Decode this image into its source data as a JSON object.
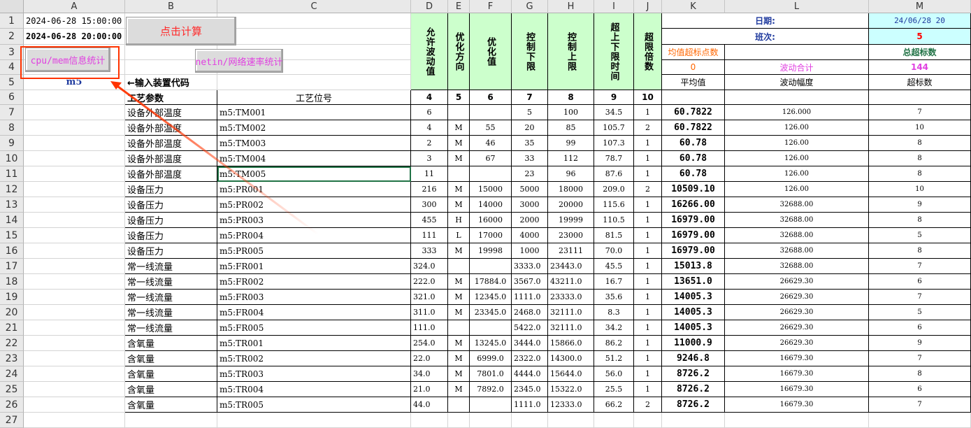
{
  "columns": [
    "A",
    "B",
    "C",
    "D",
    "E",
    "F",
    "G",
    "H",
    "I",
    "J",
    "K",
    "L",
    "M"
  ],
  "rows": [
    "1",
    "2",
    "3",
    "4",
    "5",
    "6",
    "7",
    "8",
    "9",
    "10",
    "11",
    "12",
    "13",
    "14",
    "15",
    "16",
    "17",
    "18",
    "19",
    "20",
    "21",
    "22",
    "23",
    "24",
    "25",
    "26",
    "27"
  ],
  "a1": "2024-06-28 15:00:00",
  "a2": "2024-06-28 20:00:00",
  "a5": "m5",
  "b5": "←输入装置代码",
  "b6": "工艺参数",
  "c6": "工艺位号",
  "buttons": {
    "calc": "点击计算",
    "cpu_mem": "cpu/mem信息统计",
    "netin": "netin/网络速率统计"
  },
  "headers": {
    "d": "允许波动值",
    "e": "优化方向",
    "f": "优化值",
    "g": "控制下限",
    "h": "控制上限",
    "i": "超上下限时间",
    "j": "超限倍数"
  },
  "header_nums": [
    "4",
    "5",
    "6",
    "7",
    "8",
    "9",
    "10"
  ],
  "summary": {
    "date_label": "日期:",
    "date_value": "24/06/28 20",
    "shift_label": "班次:",
    "shift_value": "5",
    "avg_exceed_label": "均值超标点数",
    "total_exceed_label": "总超标数",
    "avg_exceed_value": "0",
    "fluct_total_label": "波动合计",
    "total_exceed_value": "144",
    "k5": "平均值",
    "l5": "波动幅度",
    "m5": "超标数"
  },
  "table_rows": [
    {
      "param": "设备外部温度",
      "tag": "m5:TM001",
      "d": "6",
      "e": "",
      "f": "",
      "g": "5",
      "h": "100",
      "i": "34.5",
      "j": "1",
      "k": "60.7822",
      "l": "126.000",
      "m": "7"
    },
    {
      "param": "设备外部温度",
      "tag": "m5:TM002",
      "d": "4",
      "e": "M",
      "f": "55",
      "g": "20",
      "h": "85",
      "i": "105.7",
      "j": "2",
      "k": "60.7822",
      "l": "126.00",
      "m": "10"
    },
    {
      "param": "设备外部温度",
      "tag": "m5:TM003",
      "d": "2",
      "e": "M",
      "f": "46",
      "g": "35",
      "h": "99",
      "i": "107.3",
      "j": "1",
      "k": "60.78",
      "l": "126.00",
      "m": "8"
    },
    {
      "param": "设备外部温度",
      "tag": "m5:TM004",
      "d": "3",
      "e": "M",
      "f": "67",
      "g": "33",
      "h": "112",
      "i": "78.7",
      "j": "1",
      "k": "60.78",
      "l": "126.00",
      "m": "8"
    },
    {
      "param": "设备外部温度",
      "tag": "m5:TM005",
      "d": "11",
      "e": "",
      "f": "",
      "g": "23",
      "h": "96",
      "i": "87.6",
      "j": "1",
      "k": "60.78",
      "l": "126.00",
      "m": "8"
    },
    {
      "param": "设备压力",
      "tag": "m5:PR001",
      "d": "216",
      "e": "M",
      "f": "15000",
      "g": "5000",
      "h": "18000",
      "i": "209.0",
      "j": "2",
      "k": "10509.10",
      "l": "126.00",
      "m": "10"
    },
    {
      "param": "设备压力",
      "tag": "m5:PR002",
      "d": "300",
      "e": "M",
      "f": "14000",
      "g": "3000",
      "h": "20000",
      "i": "115.6",
      "j": "1",
      "k": "16266.00",
      "l": "32688.00",
      "m": "9"
    },
    {
      "param": "设备压力",
      "tag": "m5:PR003",
      "d": "455",
      "e": "H",
      "f": "16000",
      "g": "2000",
      "h": "19999",
      "i": "110.5",
      "j": "1",
      "k": "16979.00",
      "l": "32688.00",
      "m": "8"
    },
    {
      "param": "设备压力",
      "tag": "m5:PR004",
      "d": "111",
      "e": "L",
      "f": "17000",
      "g": "4000",
      "h": "23000",
      "i": "81.5",
      "j": "1",
      "k": "16979.00",
      "l": "32688.00",
      "m": "5"
    },
    {
      "param": "设备压力",
      "tag": "m5:PR005",
      "d": "333",
      "e": "M",
      "f": "19998",
      "g": "1000",
      "h": "23111",
      "i": "70.0",
      "j": "1",
      "k": "16979.00",
      "l": "32688.00",
      "m": "8"
    },
    {
      "param": "常一线流量",
      "tag": "m5:FR001",
      "d": "324.0",
      "e": "",
      "f": "",
      "g": "3333.0",
      "h": "23443.0",
      "i": "45.5",
      "j": "1",
      "k": "15013.8",
      "l": "32688.00",
      "m": "7"
    },
    {
      "param": "常一线流量",
      "tag": "m5:FR002",
      "d": "222.0",
      "e": "M",
      "f": "17884.0",
      "g": "3567.0",
      "h": "43211.0",
      "i": "16.7",
      "j": "1",
      "k": "13651.0",
      "l": "26629.30",
      "m": "6"
    },
    {
      "param": "常一线流量",
      "tag": "m5:FR003",
      "d": "321.0",
      "e": "M",
      "f": "12345.0",
      "g": "1111.0",
      "h": "23333.0",
      "i": "35.6",
      "j": "1",
      "k": "14005.3",
      "l": "26629.30",
      "m": "7"
    },
    {
      "param": "常一线流量",
      "tag": "m5:FR004",
      "d": "311.0",
      "e": "M",
      "f": "23345.0",
      "g": "2468.0",
      "h": "32111.0",
      "i": "8.3",
      "j": "1",
      "k": "14005.3",
      "l": "26629.30",
      "m": "5"
    },
    {
      "param": "常一线流量",
      "tag": "m5:FR005",
      "d": "111.0",
      "e": "",
      "f": "",
      "g": "5422.0",
      "h": "32111.0",
      "i": "34.2",
      "j": "1",
      "k": "14005.3",
      "l": "26629.30",
      "m": "6"
    },
    {
      "param": "含氧量",
      "tag": "m5:TR001",
      "d": "254.0",
      "e": "M",
      "f": "13245.0",
      "g": "3444.0",
      "h": "15866.0",
      "i": "86.2",
      "j": "1",
      "k": "11000.9",
      "l": "26629.30",
      "m": "9"
    },
    {
      "param": "含氧量",
      "tag": "m5:TR002",
      "d": "22.0",
      "e": "M",
      "f": "6999.0",
      "g": "2322.0",
      "h": "14300.0",
      "i": "51.2",
      "j": "1",
      "k": "9246.8",
      "l": "16679.30",
      "m": "7"
    },
    {
      "param": "含氧量",
      "tag": "m5:TR003",
      "d": "34.0",
      "e": "M",
      "f": "7801.0",
      "g": "4444.0",
      "h": "15644.0",
      "i": "56.0",
      "j": "1",
      "k": "8726.2",
      "l": "16679.30",
      "m": "8"
    },
    {
      "param": "含氧量",
      "tag": "m5:TR004",
      "d": "21.0",
      "e": "M",
      "f": "7892.0",
      "g": "2345.0",
      "h": "15322.0",
      "i": "25.5",
      "j": "1",
      "k": "8726.2",
      "l": "16679.30",
      "m": "6"
    },
    {
      "param": "含氧量",
      "tag": "m5:TR005",
      "d": "44.0",
      "e": "",
      "f": "",
      "g": "1111.0",
      "h": "12333.0",
      "i": "66.2",
      "j": "2",
      "k": "8726.2",
      "l": "16679.30",
      "m": "7"
    }
  ],
  "colors": {
    "header_green": "#ccffcc",
    "header_cyan": "#ccffff",
    "red_text": "#ff0000",
    "magenta_text": "#e040e0",
    "blue_text": "#1f3a9e",
    "dark_green_text": "#217346",
    "orange_text": "#ff6600",
    "annotation_red": "#ff3300",
    "selection_green": "#217346"
  },
  "annotation": {
    "icon": "arrow-annotation-icon"
  }
}
